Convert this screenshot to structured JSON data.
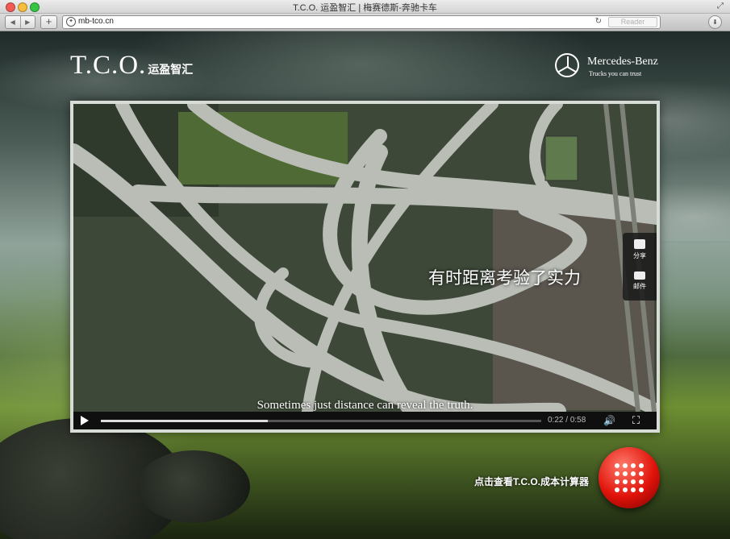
{
  "window": {
    "title": "T.C.O. 运盈智汇 | 梅赛德斯-奔驰卡车"
  },
  "toolbar": {
    "url": "mb-tco.cn",
    "reader_label": "Reader",
    "add_label": "+"
  },
  "header": {
    "logo_main": "T.C.O.",
    "logo_sub": "运盈智汇",
    "brand_name": "Mercedes-Benz",
    "brand_tagline": "Trucks you can trust"
  },
  "video": {
    "caption_cn": "有时距离考验了实力",
    "caption_en": "Sometimes just distance can reveal the truth.",
    "current_time": "0:22",
    "separator": "/",
    "duration": "0:58",
    "progress": 0.38
  },
  "share": {
    "share_label": "分享",
    "mail_label": "邮件"
  },
  "cta": {
    "label": "点击查看T.C.O.成本计算器"
  }
}
